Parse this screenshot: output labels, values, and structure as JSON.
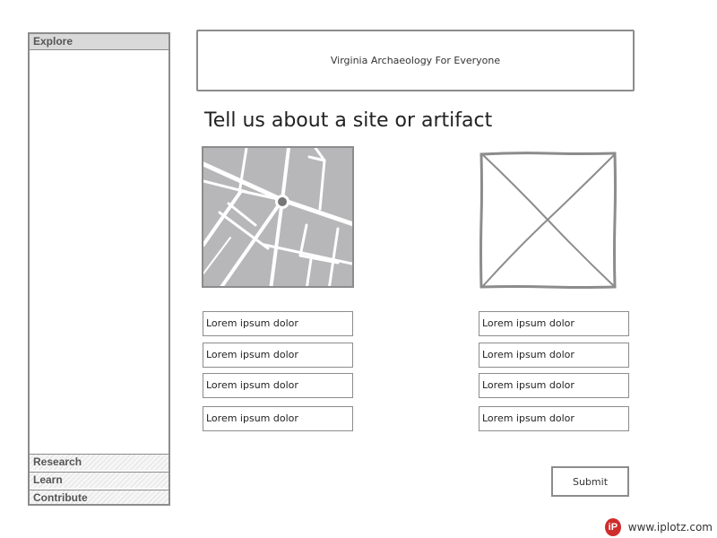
{
  "sidebar": {
    "sections": {
      "explore": "Explore",
      "research": "Research",
      "learn": "Learn",
      "contribute": "Contribute"
    }
  },
  "header": {
    "banner_text": "Virginia Archaeology For Everyone"
  },
  "main": {
    "title": "Tell us about a site or artifact",
    "left_fields": [
      "Lorem ipsum dolor",
      "Lorem ipsum dolor",
      "Lorem ipsum dolor",
      "Lorem ipsum dolor"
    ],
    "right_fields": [
      "Lorem ipsum dolor",
      "Lorem ipsum dolor",
      "Lorem ipsum dolor",
      "Lorem ipsum dolor"
    ],
    "submit_label": "Submit"
  },
  "footer": {
    "brand_logo": "iP",
    "brand_text": "www.iplotz.com"
  },
  "icons": {
    "map": "map-placeholder-icon",
    "image": "image-placeholder-icon"
  },
  "colors": {
    "border": "#8c8c8c",
    "map_fill": "#b7b7b9",
    "brand_red": "#cf2c2c"
  }
}
